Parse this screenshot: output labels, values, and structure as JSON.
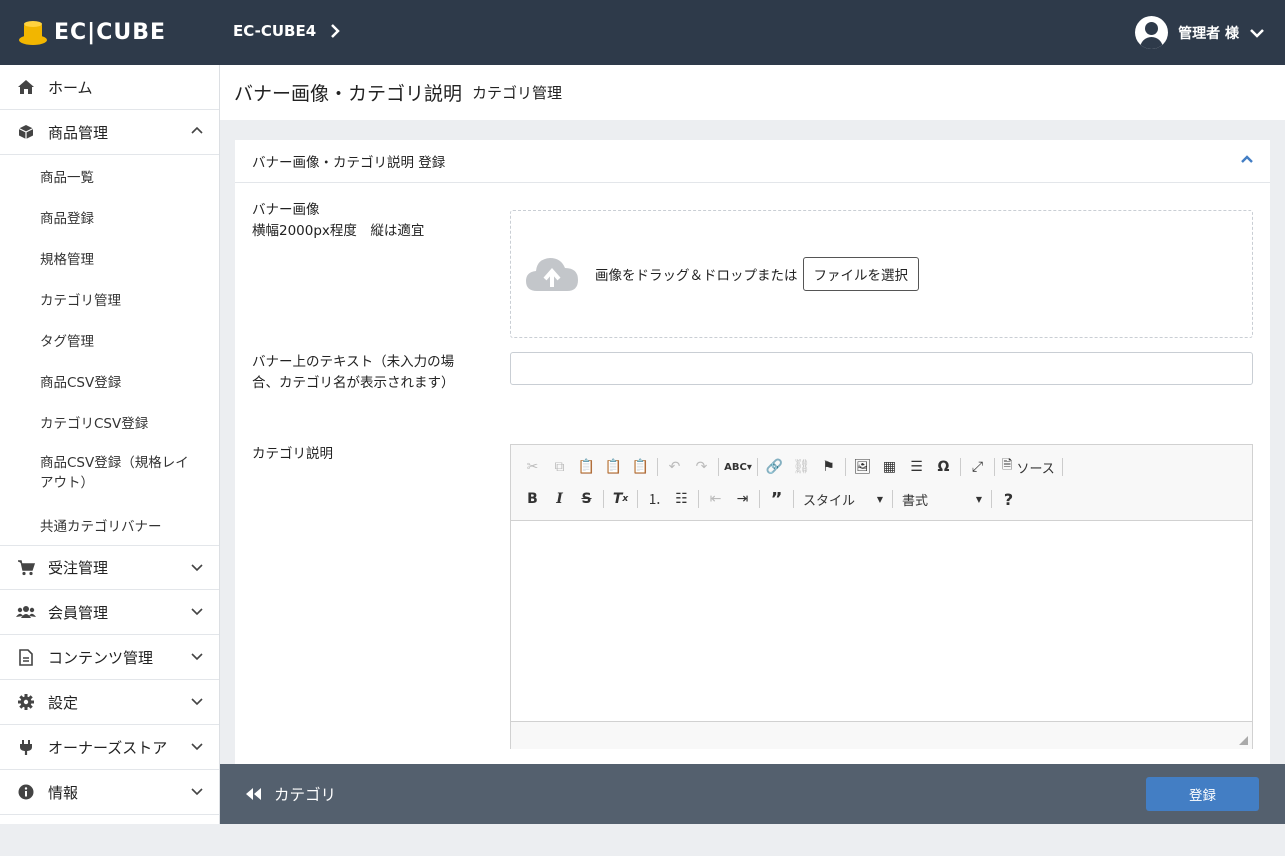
{
  "header": {
    "logo_text": "EC|CUBE",
    "shop_name": "EC-CUBE4",
    "user_name": "管理者 様"
  },
  "sidebar": {
    "items": [
      {
        "label": "ホーム",
        "icon": "home-icon"
      },
      {
        "label": "商品管理",
        "icon": "box-icon",
        "expanded": true,
        "children": [
          "商品一覧",
          "商品登録",
          "規格管理",
          "カテゴリ管理",
          "タグ管理",
          "商品CSV登録",
          "カテゴリCSV登録",
          "商品CSV登録（規格レイアウト）",
          "共通カテゴリバナー"
        ]
      },
      {
        "label": "受注管理",
        "icon": "cart-icon"
      },
      {
        "label": "会員管理",
        "icon": "users-icon"
      },
      {
        "label": "コンテンツ管理",
        "icon": "file-icon"
      },
      {
        "label": "設定",
        "icon": "gear-icon"
      },
      {
        "label": "オーナーズストア",
        "icon": "plug-icon"
      },
      {
        "label": "情報",
        "icon": "info-icon"
      }
    ]
  },
  "page": {
    "title": "バナー画像・カテゴリ説明",
    "subtitle": "カテゴリ管理"
  },
  "card": {
    "title": "バナー画像・カテゴリ説明 登録",
    "banner_label": "バナー画像",
    "banner_hint": "横幅2000px程度　縦は適宜",
    "dropzone_text": "画像をドラッグ＆ドロップまたは",
    "file_button": "ファイルを選択",
    "banner_text_label": "バナー上のテキスト（未入力の場合、カテゴリ名が表示されます）",
    "banner_text_value": "",
    "description_label": "カテゴリ説明"
  },
  "editor": {
    "source_label": "ソース",
    "style_label": "スタイル",
    "format_label": "書式"
  },
  "footer": {
    "back_label": "カテゴリ",
    "save_label": "登録"
  },
  "colors": {
    "header_bg": "#2e3a4a",
    "footer_bg": "#54606e",
    "primary": "#437ec4",
    "accent": "#f2b600"
  }
}
